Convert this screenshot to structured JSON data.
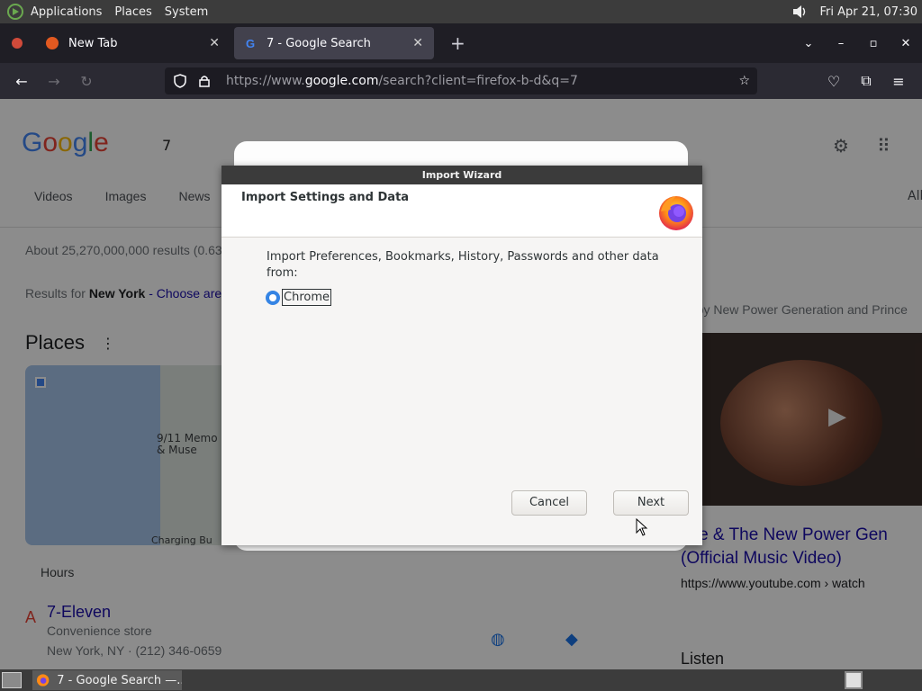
{
  "system_panel": {
    "menus": [
      "Applications",
      "Places",
      "System"
    ],
    "clock": "Fri Apr 21, 07:30"
  },
  "browser": {
    "tabs": [
      {
        "title": "New Tab",
        "close": "✕"
      },
      {
        "title": "7 - Google Search",
        "close": "✕"
      }
    ],
    "new_tab": "+",
    "url_host_prefix": "https://www.",
    "url_host": "google.com",
    "url_path": "/search?client=firefox-b-d&q=7"
  },
  "page": {
    "query": "7",
    "filters": [
      "Videos",
      "Images",
      "News"
    ],
    "all_right": "All",
    "about": "About 25,270,000,000 results (0.63",
    "results_for_prefix": "Results for",
    "results_for_location": "New York",
    "choose_area": "- Choose are",
    "places_title": "Places",
    "map_label": "9/11 Memo\n& Muse",
    "map_label2": "Charging Bu",
    "hours": "Hours",
    "marker": "A",
    "store_name": "7-Eleven",
    "store_type": "Convenience store",
    "store_addr": "New York, NY · (212) 346-0659",
    "video_caption": "g by New Power Generation and Prince",
    "video_title_1": "nce & The New Power Gen",
    "video_title_2": "(Official Music Video)",
    "video_url": "https://www.youtube.com › watch",
    "listen": "Listen"
  },
  "wizard": {
    "title": "Import Wizard",
    "heading": "Import Settings and Data",
    "description": "Import Preferences, Bookmarks, History, Passwords and other data from:",
    "options": [
      {
        "label": "Chrome",
        "selected": true
      }
    ],
    "cancel_label": "Cancel",
    "next_label": "Next"
  },
  "taskbar": {
    "task_label": "7 - Google Search —..."
  }
}
